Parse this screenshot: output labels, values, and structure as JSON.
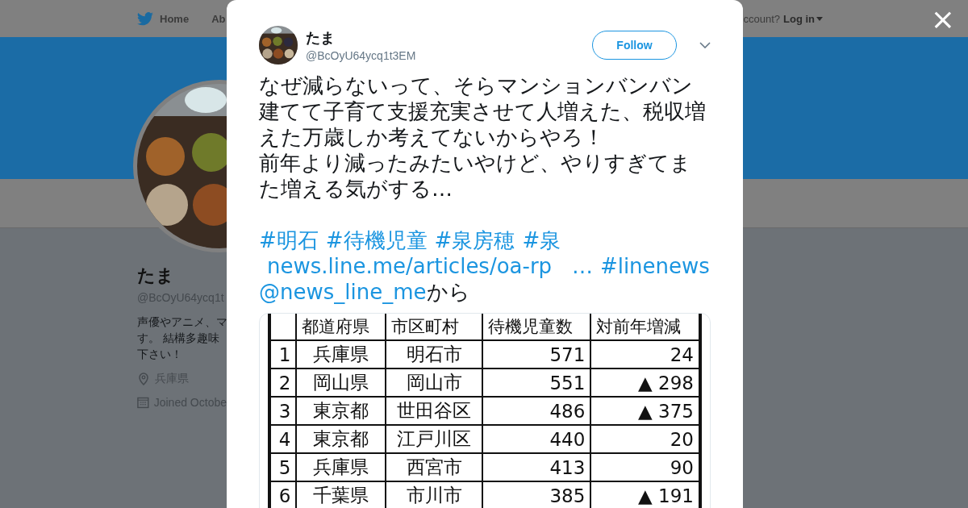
{
  "nav": {
    "items": [
      "Home",
      "Ab"
    ],
    "account_prompt": "ccount?",
    "login": "Log in"
  },
  "profile": {
    "name": "たま",
    "handle": "@BcOyU64ycq1t",
    "bio": [
      "声優やアニメ、マ",
      "す。 結構多趣味",
      "下さい！"
    ],
    "location": "兵庫県",
    "joined": "Joined Octobe"
  },
  "tweet": {
    "author": "たま",
    "handle": "@BcOyU64ycq1t3EM",
    "follow": "Follow",
    "text": [
      "なぜ減らないって、そらマンションバンバン建てて子育て支援充実させて人増えた、税収増えた万歳しか考えてないからやろ！",
      "前年より減ったみたいやけど、やりすぎてまた増える気がする…"
    ],
    "links": [
      {
        "kind": "hashtag",
        "text": "#明石"
      },
      {
        "kind": "hashtag",
        "text": "#待機児童"
      },
      {
        "kind": "hashtag",
        "text": "#泉房穂"
      },
      {
        "kind": "hashtag",
        "text": "#泉"
      },
      {
        "kind": "url",
        "text": "news.line.me/articles/oa-rp   …"
      },
      {
        "kind": "hashtag",
        "text": "#linenews"
      },
      {
        "kind": "mention",
        "text": "@news_line_me"
      },
      {
        "kind": "text",
        "text": "から"
      }
    ],
    "table": {
      "columns": [
        "",
        "都道府県",
        "市区町村",
        "待機児童数",
        "対前年増減"
      ],
      "rows": [
        [
          "1",
          "兵庫県",
          "明石市",
          "571",
          "24"
        ],
        [
          "2",
          "岡山県",
          "岡山市",
          "551",
          "▲ 298"
        ],
        [
          "3",
          "東京都",
          "世田谷区",
          "486",
          "▲ 375"
        ],
        [
          "4",
          "東京都",
          "江戸川区",
          "440",
          "20"
        ],
        [
          "5",
          "兵庫県",
          "西宮市",
          "413",
          "90"
        ],
        [
          "6",
          "千葉県",
          "市川市",
          "385",
          "▲ 191"
        ]
      ]
    }
  },
  "close": "×"
}
